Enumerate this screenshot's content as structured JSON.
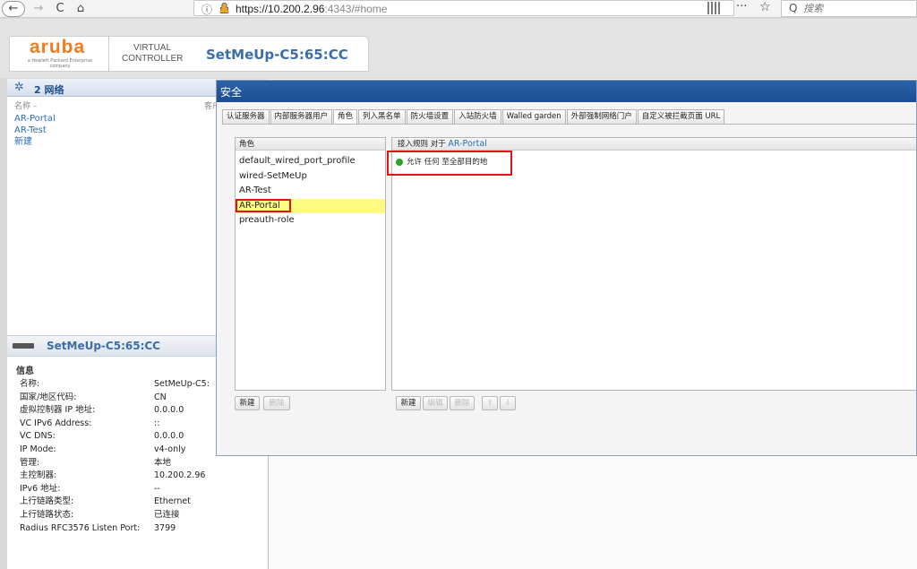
{
  "browser": {
    "url_host": "https://10.200.2.96",
    "url_rest": ":4343/#home",
    "search_placeholder": "搜索",
    "back": "←",
    "forward": "→",
    "reload": "C",
    "home": "⌂",
    "info": "ⓘ",
    "more": "···",
    "star": "☆",
    "search_glyph": "Q"
  },
  "header": {
    "logo_word": "aruba",
    "logo_sub": "a Hewlett Packard Enterprise company",
    "vc_label": "VIRTUAL CONTROLLER",
    "vc_name": "SetMeUp-C5:65:CC"
  },
  "networks": {
    "title": "2 网络",
    "col_name": "名称 –",
    "col_client": "客户",
    "items": [
      "AR-Portal",
      "AR-Test",
      "新建"
    ]
  },
  "details": {
    "title": "SetMeUp-C5:65:CC",
    "info_label": "信息",
    "rows": [
      {
        "key": "名称:",
        "value": "SetMeUp-C5:"
      },
      {
        "key": "国家/地区代码:",
        "value": "CN"
      },
      {
        "key": "虚拟控制器 IP 地址:",
        "value": "0.0.0.0"
      },
      {
        "key": "VC IPv6 Address:",
        "value": "::"
      },
      {
        "key": "VC DNS:",
        "value": "0.0.0.0"
      },
      {
        "key": "IP Mode:",
        "value": "v4-only"
      },
      {
        "key": "管理:",
        "value": "本地"
      },
      {
        "key": "主控制器:",
        "value": "10.200.2.96"
      },
      {
        "key": "IPv6 地址:",
        "value": "--"
      },
      {
        "key": "上行链路类型:",
        "value": "Ethernet"
      },
      {
        "key": "上行链路状态:",
        "value": "已连接"
      },
      {
        "key": "Radius RFC3576 Listen Port:",
        "value": "3799"
      }
    ]
  },
  "dialog": {
    "title": "安全",
    "tabs": [
      "认证服务器",
      "内部服务器用户",
      "角色",
      "列入黑名单",
      "防火墙设置",
      "入站防火墙",
      "Walled garden",
      "外部强制网络门户",
      "自定义被拦截页面 URL"
    ],
    "active_tab": "角色",
    "roles_header": "角色",
    "roles": [
      "default_wired_port_profile",
      "wired-SetMeUp",
      "AR-Test",
      "AR-Portal",
      "preauth-role"
    ],
    "selected_role": "AR-Portal",
    "rules_header_prefix": "接入规则 对于",
    "rules_header_role": "AR-Portal",
    "rule_text": "允许 任何 至全部目的地",
    "rule_status_color": "#2aa52a",
    "roles_buttons": {
      "new": "新建",
      "delete": "删除"
    },
    "rules_buttons": {
      "new": "新建",
      "edit": "编辑",
      "delete": "删除",
      "up": "⇧",
      "down": "⇩"
    }
  }
}
